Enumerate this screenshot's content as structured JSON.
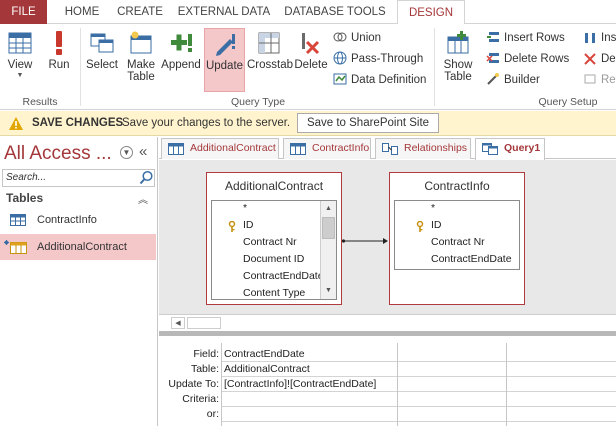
{
  "ribbon_tabs": [
    "FILE",
    "HOME",
    "CREATE",
    "EXTERNAL DATA",
    "DATABASE TOOLS",
    "DESIGN"
  ],
  "ribbon": {
    "results": {
      "label": "Results",
      "buttons": [
        "View",
        "Run"
      ]
    },
    "query_type": {
      "label": "Query Type",
      "buttons": [
        "Select",
        "Make Table",
        "Append",
        "Update",
        "Crosstab",
        "Delete"
      ],
      "small_buttons": [
        "Union",
        "Pass-Through",
        "Data Definition"
      ]
    },
    "query_setup": {
      "label": "Query Setup",
      "show_table": "Show Table",
      "small_buttons": [
        "Insert Rows",
        "Delete Rows",
        "Builder"
      ],
      "cut_right": [
        "Inse",
        "Del",
        "Ret"
      ]
    }
  },
  "message_bar": {
    "title": "SAVE CHANGES",
    "text": "Save your changes to the server.",
    "button": "Save to SharePoint Site"
  },
  "nav_pane": {
    "title": "All Access ...",
    "search_placeholder": "Search...",
    "section": "Tables",
    "items": [
      "ContractInfo",
      "AdditionalContract"
    ],
    "selected": "AdditionalContract"
  },
  "doc_tabs": [
    "AdditionalContract",
    "ContractInfo",
    "Relationships",
    "Query1"
  ],
  "active_doc_tab": "Query1",
  "tables": [
    {
      "name": "AdditionalContract",
      "fields": [
        "*",
        "ID",
        "Contract Nr",
        "Document ID",
        "ContractEndDate",
        "Content Type"
      ]
    },
    {
      "name": "ContractInfo",
      "fields": [
        "*",
        "ID",
        "Contract Nr",
        "ContractEndDate"
      ]
    }
  ],
  "grid": {
    "row_labels": [
      "Field:",
      "Table:",
      "Update To:",
      "Criteria:",
      "or:"
    ],
    "column1": {
      "field": "ContractEndDate",
      "table": "AdditionalContract",
      "update_to": "[ContractInfo]![ContractEndDate]"
    }
  },
  "colors": {
    "accent": "#a4373a",
    "selected_bg": "#f4c7c9",
    "message_bar_bg": "#fff4ce",
    "design_bg": "#e8e8e8"
  }
}
